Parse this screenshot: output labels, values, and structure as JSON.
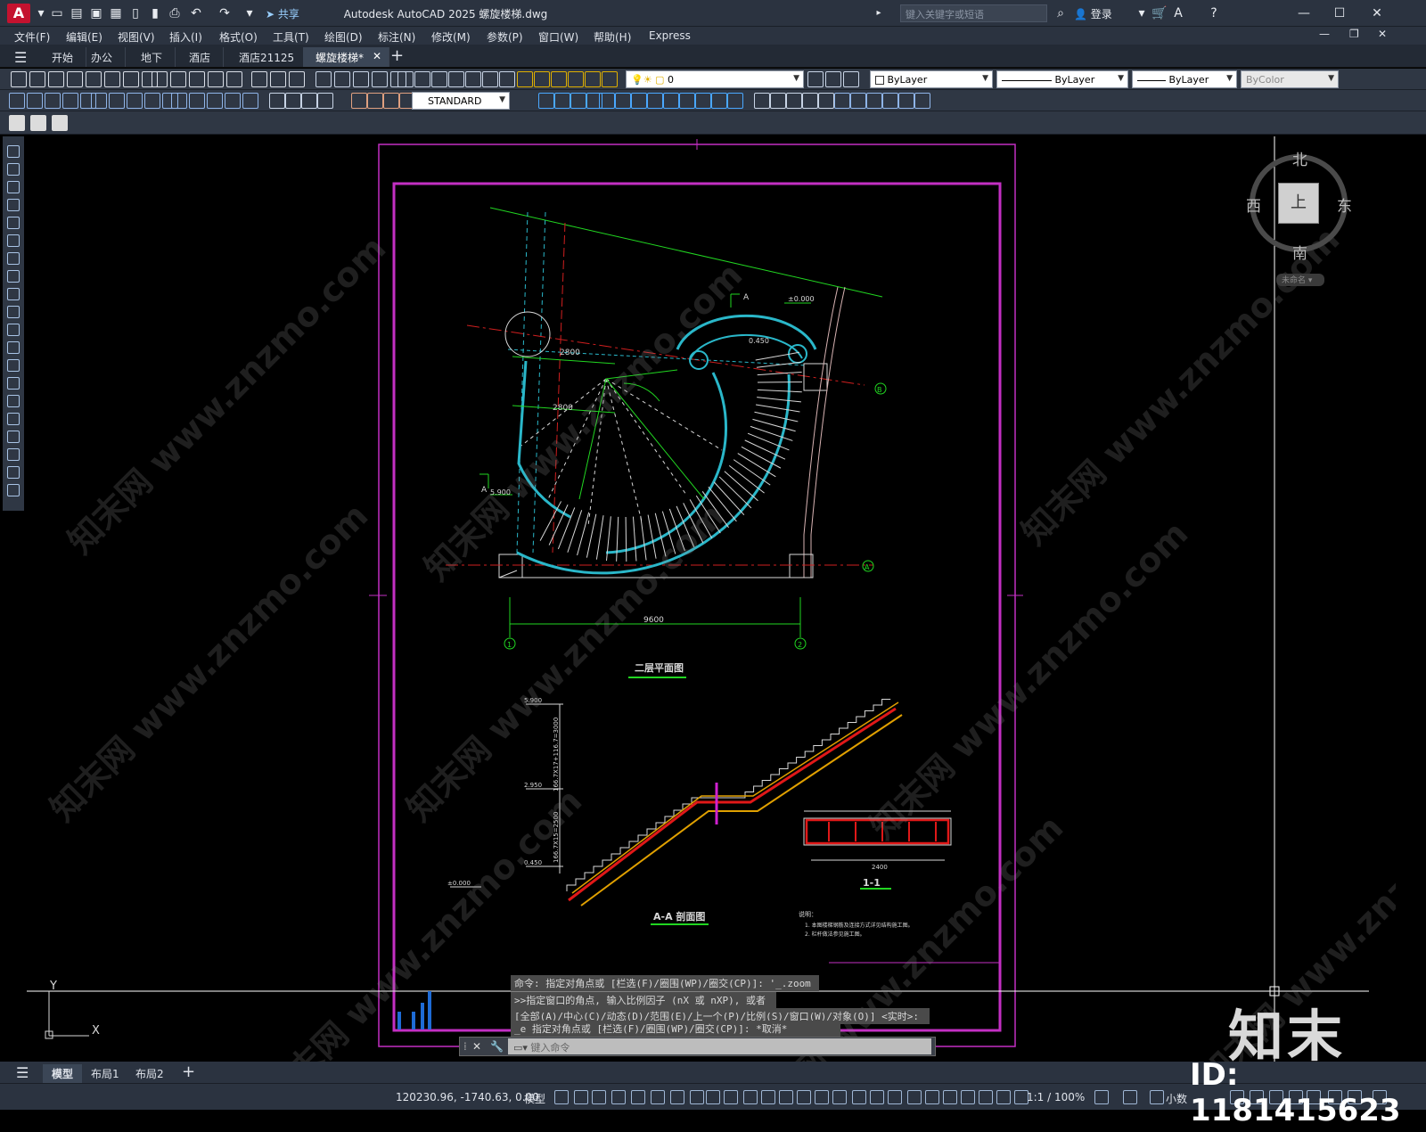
{
  "window": {
    "app_logo": "A",
    "title": "Autodesk AutoCAD 2025    螺旋楼梯.dwg",
    "share_label": "共享",
    "search_placeholder": "键入关键字或短语",
    "login_label": "登录"
  },
  "menu": [
    "文件(F)",
    "编辑(E)",
    "视图(V)",
    "插入(I)",
    "格式(O)",
    "工具(T)",
    "绘图(D)",
    "标注(N)",
    "修改(M)",
    "参数(P)",
    "窗口(W)",
    "帮助(H)",
    "Express"
  ],
  "tabs": [
    {
      "label": "开始"
    },
    {
      "label": "办公"
    },
    {
      "label": "地下"
    },
    {
      "label": "酒店"
    },
    {
      "label": "酒店21125"
    },
    {
      "label": "螺旋楼梯*",
      "active": true
    }
  ],
  "toolbar": {
    "layer_value": "0",
    "color_value": "ByLayer",
    "linetype_value": "ByLayer",
    "lineweight_value": "ByLayer",
    "plotstyle_value": "ByColor",
    "dimstyle_value": "STANDARD"
  },
  "viewcube": {
    "north": "北",
    "south": "南",
    "east": "东",
    "west": "西",
    "top": "上",
    "wcs": "未命名"
  },
  "drawing": {
    "plan_title": "二层平面图",
    "section_title": "A-A  剖面图",
    "detail_title": "1-1",
    "dim_2800_a": "2800",
    "dim_2800_b": "2800",
    "dim_9600": "9600",
    "elev_0000": "±0.000",
    "elev_0450": "0.450",
    "elev_5900": "5.900",
    "sec_label_a": "A",
    "sec_label_a2": "A",
    "axis_b": "B",
    "axis_a": "A",
    "axis_1": "1",
    "axis_2": "2",
    "sec_elev_5900": "5.900",
    "sec_elev_2950": "2.950",
    "sec_elev_0450": "0.450",
    "sec_elev_0000": "±0.000",
    "sec_dim_top": "166.7X17+116.7=3000",
    "sec_dim_bottom": "166.7X15=2500",
    "detail_dim": "2400",
    "notes_title": "说明：",
    "note_1": "1. 本图楼梯钢筋及连接方式详见结构施工图。",
    "note_2": "2. 栏杆做法参见施工图。"
  },
  "command": {
    "line1": "命令: 指定对角点或 [栏选(F)/圈围(WP)/圈交(CP)]: '_.zoom",
    "line2": ">>指定窗口的角点, 输入比例因子 (nX 或 nXP), 或者",
    "line3": "[全部(A)/中心(C)/动态(D)/范围(E)/上一个(P)/比例(S)/窗口(W)/对象(O)] <实时>:",
    "line4": "_e 指定对角点或 [栏选(F)/圈围(WP)/圈交(CP)]: *取消*",
    "input_placeholder": "键入命令"
  },
  "layout_tabs": [
    "模型",
    "布局1",
    "布局2"
  ],
  "status": {
    "coords": "120230.96, -1740.63, 0.00",
    "model_label": "模型",
    "scale": "1:1 / 100%",
    "units": "小数"
  },
  "watermark": {
    "logo": "知末",
    "id": "ID: 1181415623",
    "site": "知末网 www.znzmo.com"
  },
  "ucs": {
    "x": "X",
    "y": "Y"
  }
}
